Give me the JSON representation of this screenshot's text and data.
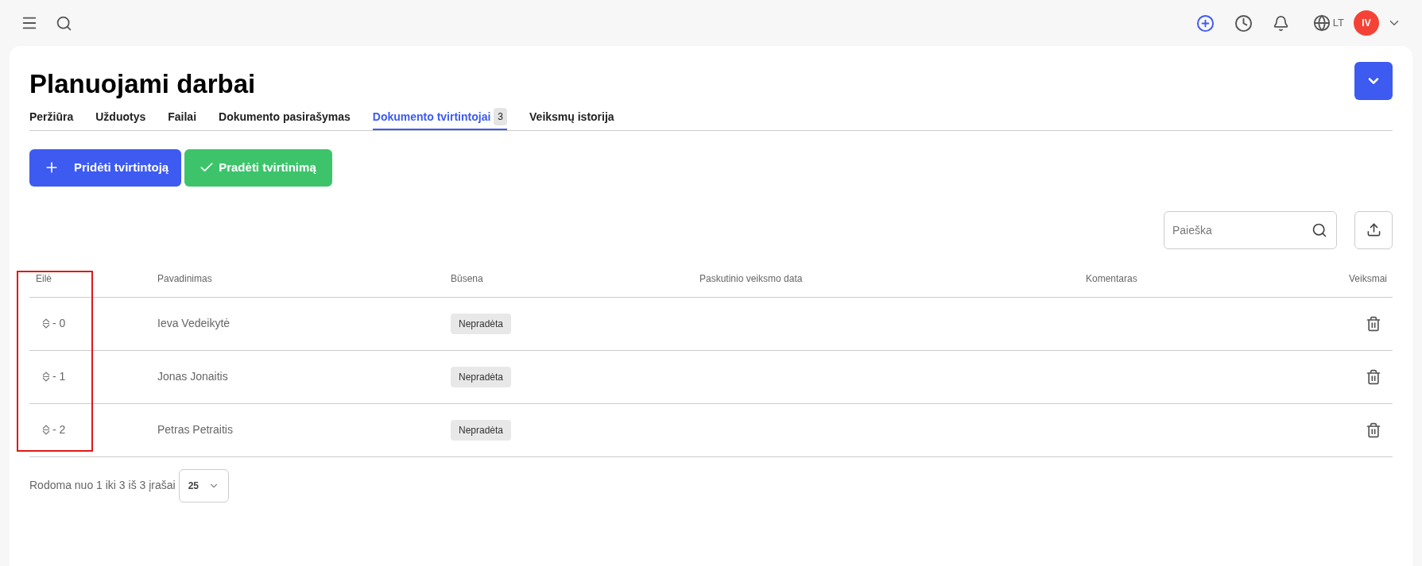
{
  "top_bar": {
    "language": "LT",
    "avatar": "IV"
  },
  "page": {
    "title": "Planuojami darbai"
  },
  "tabs": [
    {
      "label": "Peržiūra",
      "selected": false
    },
    {
      "label": "Užduotys",
      "selected": false
    },
    {
      "label": "Failai",
      "selected": false
    },
    {
      "label": "Dokumento pasirašymas",
      "selected": false
    },
    {
      "label": "Dokumento tvirtintojai",
      "selected": true,
      "count": "3"
    },
    {
      "label": "Veiksmų istorija",
      "selected": false
    }
  ],
  "actions": [
    {
      "label": "Pridėti tvirtintoją",
      "kind": "add"
    },
    {
      "label": "Pradėti tvirtinimą",
      "kind": "start"
    }
  ],
  "search": {
    "placeholder": "Paieška"
  },
  "table": {
    "columns": [
      "Eilė",
      "Pavadinimas",
      "Būsena",
      "Paskutinio veiksmo data",
      "Komentaras",
      "Veiksmai"
    ],
    "rows": [
      {
        "order": "- 0",
        "name": "Ieva Vedeikytė",
        "status": "Nepradėta"
      },
      {
        "order": "- 1",
        "name": "Jonas Jonaitis",
        "status": "Nepradėta"
      },
      {
        "order": "- 2",
        "name": "Petras Petraitis",
        "status": "Nepradėta"
      }
    ]
  },
  "pagination": {
    "summary": "Rodoma nuo 1 iki 3 iš 3 įrašai",
    "page_size": "25"
  }
}
